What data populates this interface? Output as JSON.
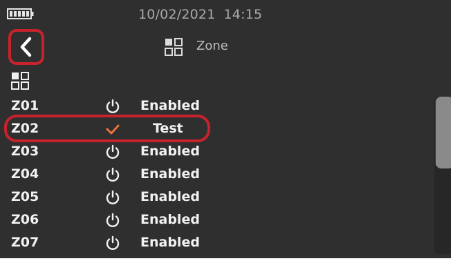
{
  "status_bar": {
    "date": "10/02/2021",
    "time": "14:15",
    "battery_icon": "battery-full-icon"
  },
  "header": {
    "title": "Zone",
    "title_icon": "zone-grid-icon",
    "back_icon": "chevron-left-icon"
  },
  "colors": {
    "background": "#2f2f2f",
    "text": "#f2f2f2",
    "muted_text": "#a9a9a9",
    "accent_check": "#e8743b",
    "annotation_red": "#c8232c"
  },
  "zones": [
    {
      "id": "Z01",
      "status": "Enabled",
      "icon": "power-icon"
    },
    {
      "id": "Z02",
      "status": "Test",
      "icon": "check-icon"
    },
    {
      "id": "Z03",
      "status": "Enabled",
      "icon": "power-icon"
    },
    {
      "id": "Z04",
      "status": "Enabled",
      "icon": "power-icon"
    },
    {
      "id": "Z05",
      "status": "Enabled",
      "icon": "power-icon"
    },
    {
      "id": "Z06",
      "status": "Enabled",
      "icon": "power-icon"
    },
    {
      "id": "Z07",
      "status": "Enabled",
      "icon": "power-icon"
    }
  ]
}
